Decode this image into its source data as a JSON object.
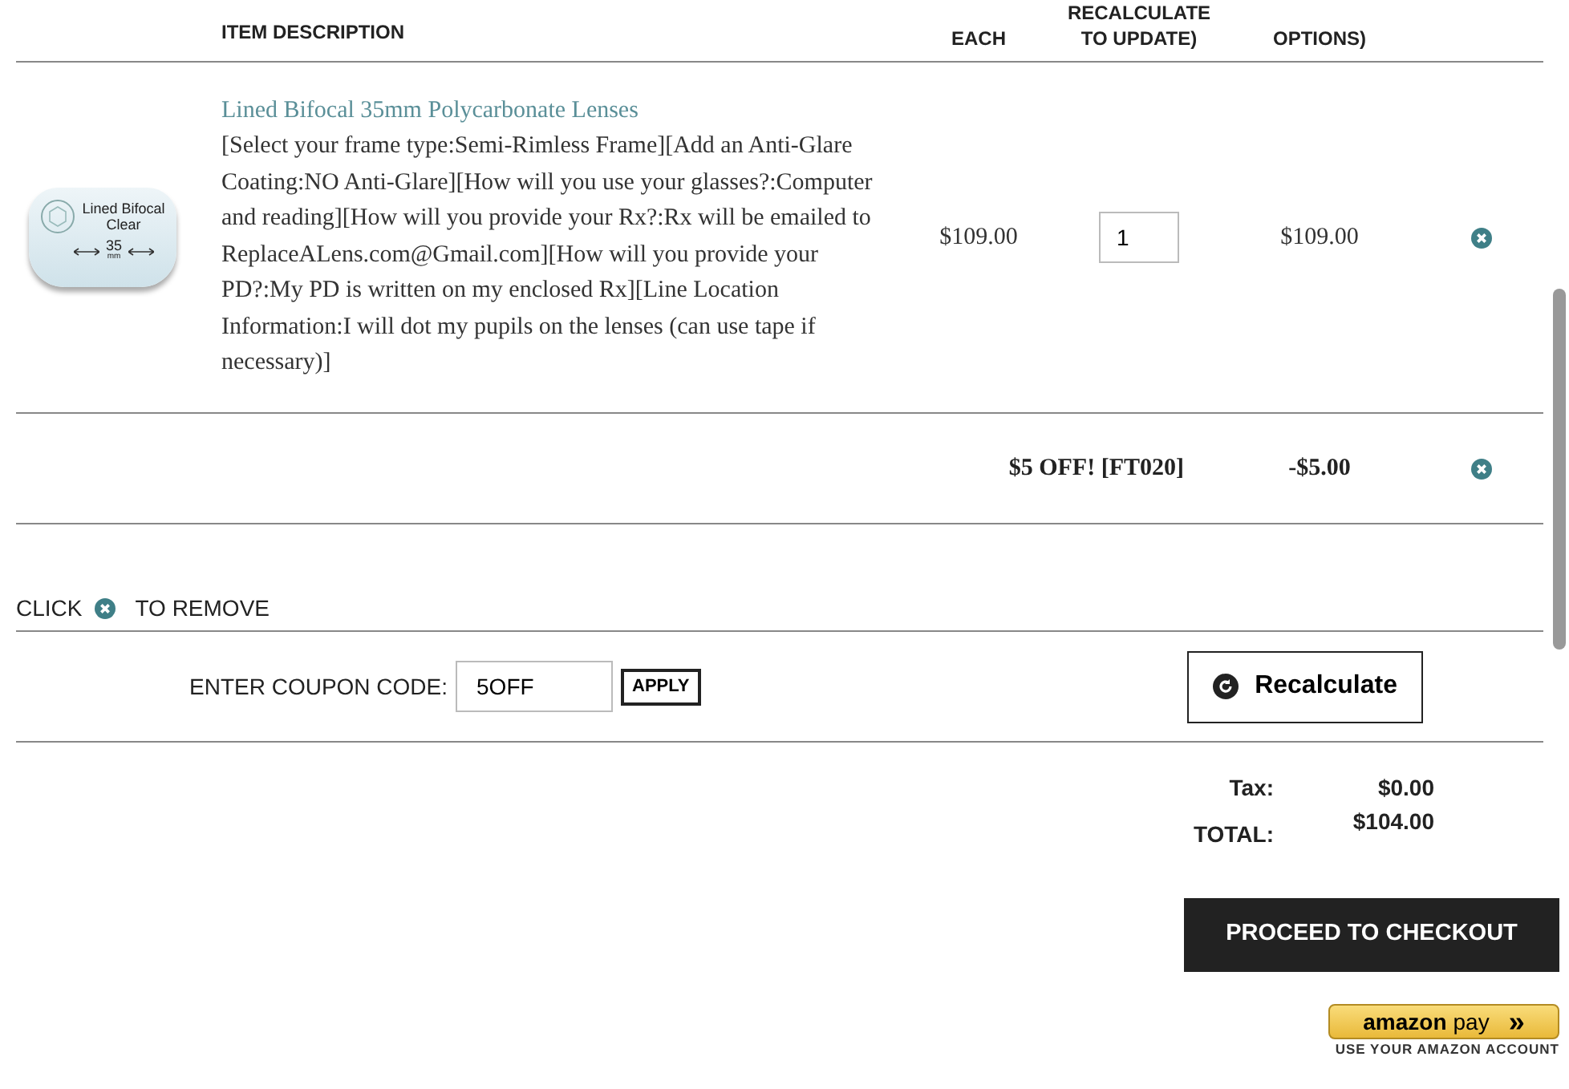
{
  "header": {
    "columns": [
      {
        "kind": "desc",
        "label": "ITEM DESCRIPTION"
      },
      {
        "kind": "each",
        "label": "EACH"
      },
      {
        "kind": "qty",
        "label": "RECALCULATE TO UPDATE)"
      },
      {
        "kind": "total",
        "label": "OPTIONS)"
      }
    ]
  },
  "items": [
    {
      "kind": "product",
      "image_label": "Lined Bifocal Clear",
      "image_size": "35",
      "image_unit": "mm",
      "name": "Lined Bifocal 35mm Polycarbonate Lenses",
      "options": "[Select your frame type:Semi-Rimless Frame][Add an Anti-Glare Coating:NO Anti-Glare][How will you use your glasses?:Computer and reading][How will you provide your Rx?:Rx will be emailed to ReplaceALens.com@Gmail.com][How will you provide your PD?:My PD is written on my enclosed Rx][Line Location Information:I will dot my pupils on the lenses (can use tape if necessary)]",
      "each": "$109.00",
      "quantity": "1",
      "total": "$109.00"
    },
    {
      "kind": "coupon",
      "name": "$5 OFF! [FT020]",
      "total": "-$5.00"
    }
  ],
  "remove_hint": {
    "before": "CLICK",
    "after": "TO REMOVE"
  },
  "coupon": {
    "label": "ENTER COUPON CODE:",
    "value": "5OFF",
    "apply": "APPLY"
  },
  "recalculate": "Recalculate",
  "summary": [
    {
      "label": "Tax:",
      "value": "$0.00"
    },
    {
      "label": "TOTAL:",
      "value": "$104.00"
    }
  ],
  "checkout": "PROCEED TO CHECKOUT",
  "amazon": {
    "brand": "amazon",
    "pay": "pay",
    "arrows": "»",
    "caption": "USE YOUR AMAZON ACCOUNT"
  }
}
